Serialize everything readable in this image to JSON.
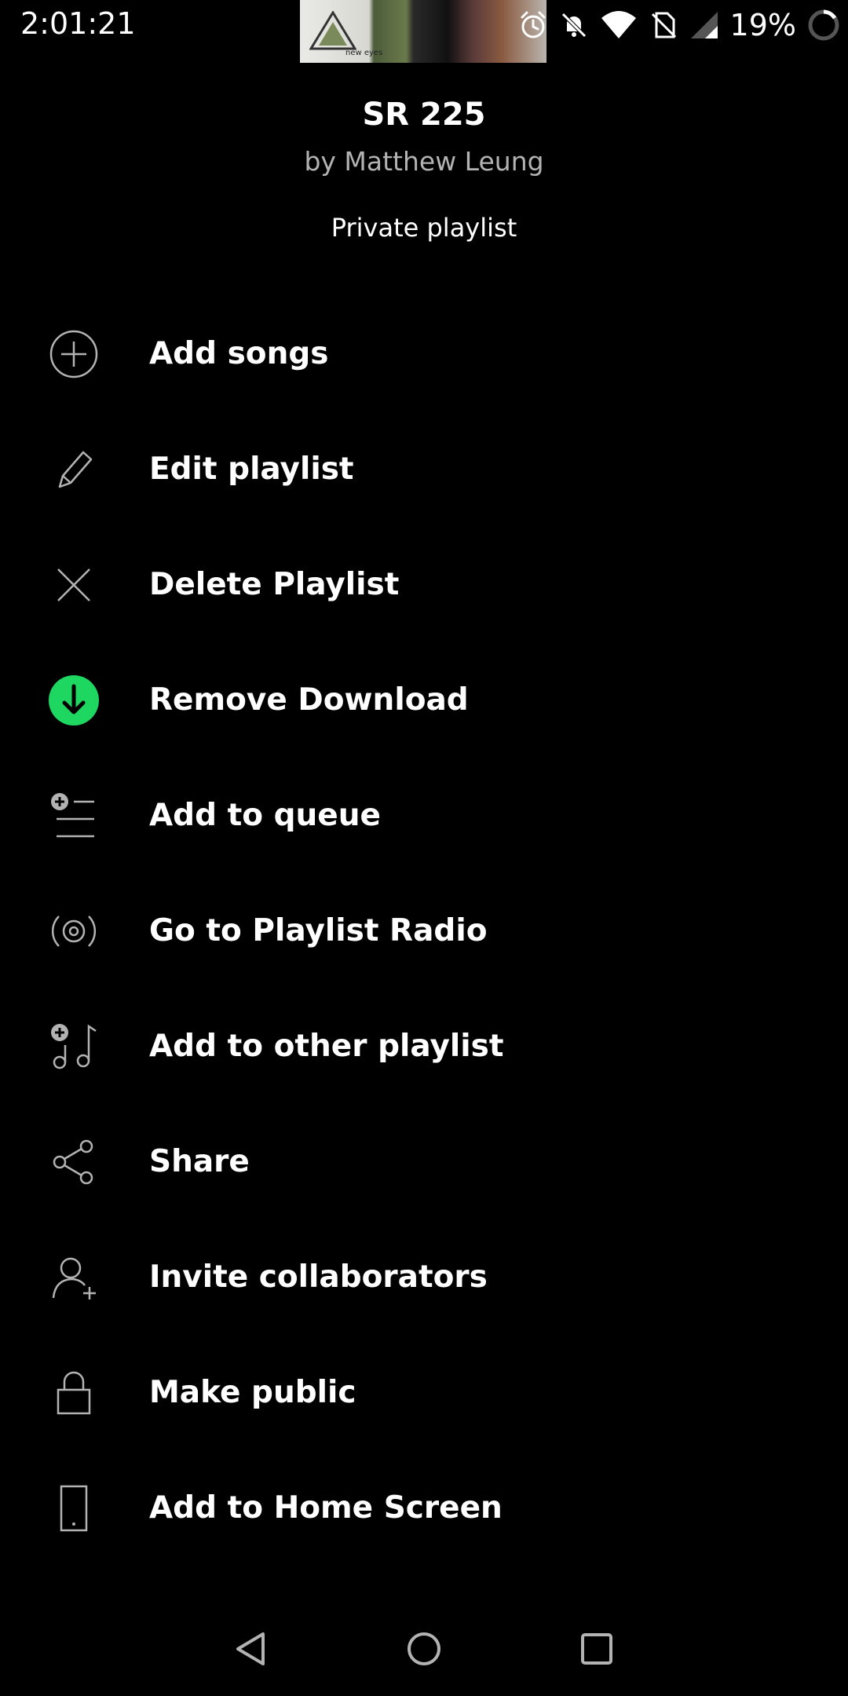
{
  "status_bar": {
    "time": "2:01:21",
    "battery_percent": "19%",
    "album_thumb_caption": "new eyes",
    "icons": [
      "alarm-icon",
      "notifications-off-icon",
      "wifi-icon",
      "no-sim-icon",
      "signal-icon",
      "battery-saver-icon"
    ]
  },
  "playlist": {
    "title": "SR 225",
    "owner": "by Matthew Leung",
    "privacy": "Private playlist"
  },
  "menu": {
    "items": [
      {
        "label": "Add songs",
        "icon": "add-circle-icon"
      },
      {
        "label": "Edit playlist",
        "icon": "pencil-icon"
      },
      {
        "label": "Delete Playlist",
        "icon": "close-icon"
      },
      {
        "label": "Remove Download",
        "icon": "downloaded-icon"
      },
      {
        "label": "Add to queue",
        "icon": "add-to-queue-icon"
      },
      {
        "label": "Go to Playlist Radio",
        "icon": "radio-icon"
      },
      {
        "label": "Add to other playlist",
        "icon": "add-to-playlist-icon"
      },
      {
        "label": "Share",
        "icon": "share-icon"
      },
      {
        "label": "Invite collaborators",
        "icon": "add-user-icon"
      },
      {
        "label": "Make public",
        "icon": "lock-icon"
      },
      {
        "label": "Add to Home Screen",
        "icon": "phone-icon"
      }
    ]
  },
  "colors": {
    "background": "#000000",
    "text_primary": "#ffffff",
    "text_secondary": "#b3b3b3",
    "icon_gray": "#b3b3b3",
    "download_green": "#1ed760"
  },
  "nav_bar": {
    "buttons": [
      "back-icon",
      "home-icon",
      "recents-icon"
    ]
  }
}
